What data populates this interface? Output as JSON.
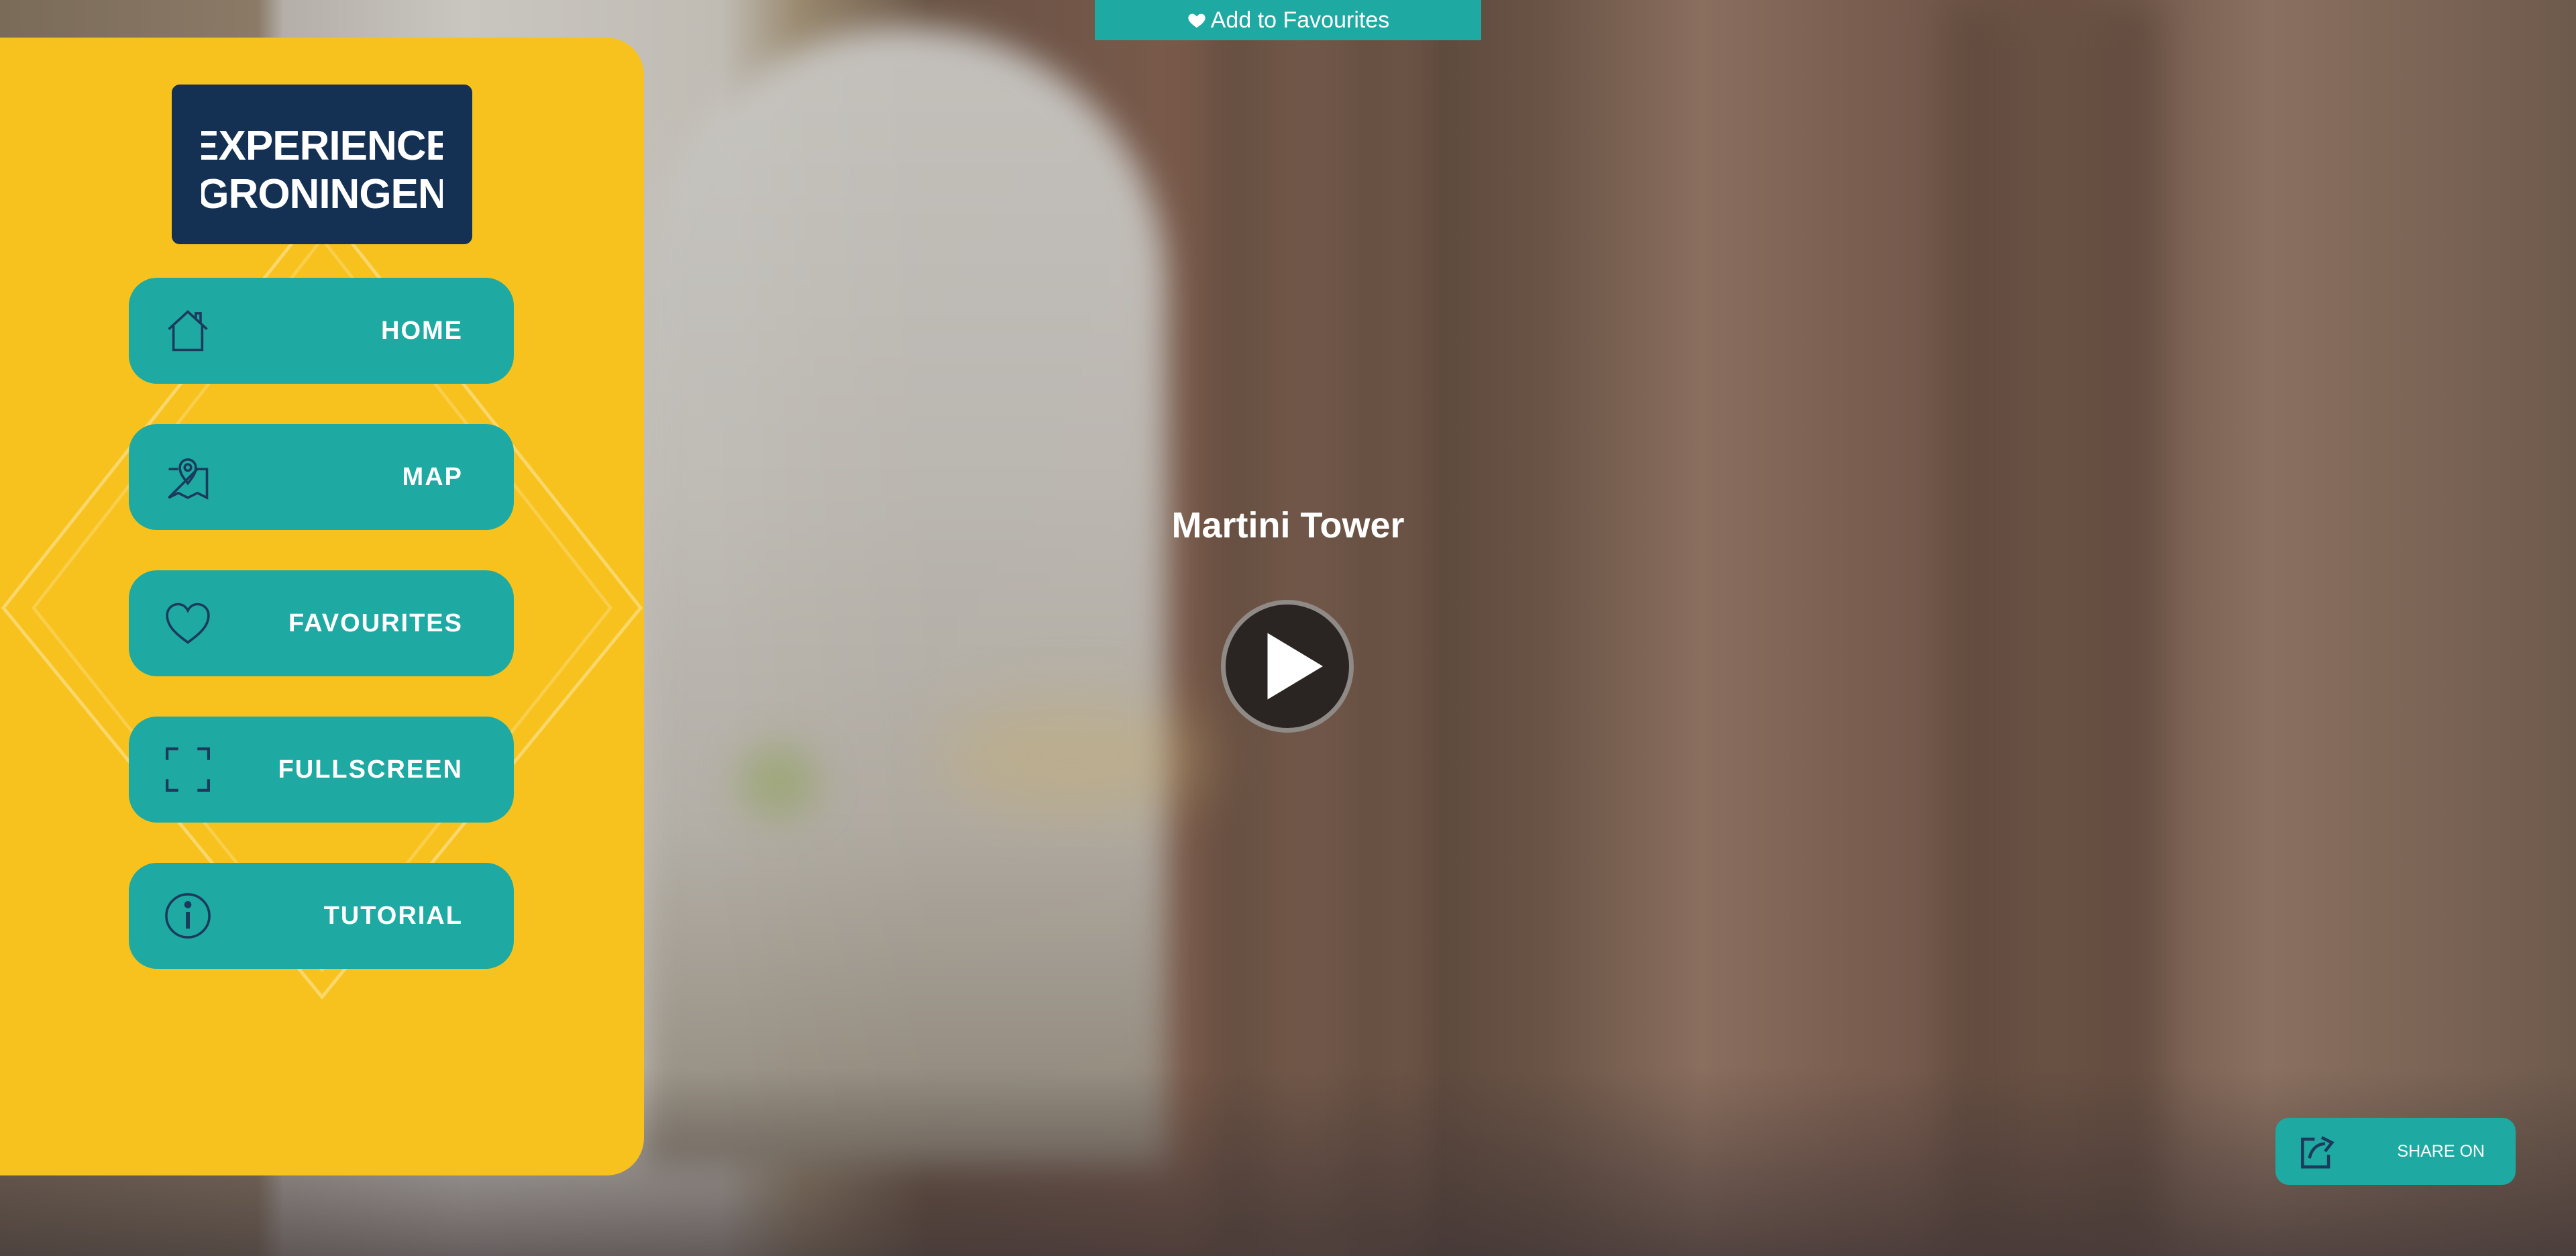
{
  "top_banner": {
    "label": "Add to Favourites",
    "icon": "heart-icon"
  },
  "sidebar": {
    "logo": {
      "line1": "EXPERIENCE",
      "line2": "GRONINGEN"
    },
    "items": [
      {
        "label": "HOME",
        "icon": "home-icon"
      },
      {
        "label": "MAP",
        "icon": "map-pin-icon"
      },
      {
        "label": "FAVOURITES",
        "icon": "heart-outline-icon"
      },
      {
        "label": "FULLSCREEN",
        "icon": "fullscreen-icon"
      },
      {
        "label": "TUTORIAL",
        "icon": "info-icon"
      }
    ]
  },
  "main": {
    "title": "Martini Tower",
    "play_icon": "play-icon"
  },
  "share": {
    "label": "SHARE ON",
    "icon": "share-icon"
  },
  "colors": {
    "accent_teal": "#1eaaa2",
    "sidebar_yellow": "#f7c21d",
    "logo_navy": "#143052",
    "icon_navy": "#1b3a5c"
  }
}
